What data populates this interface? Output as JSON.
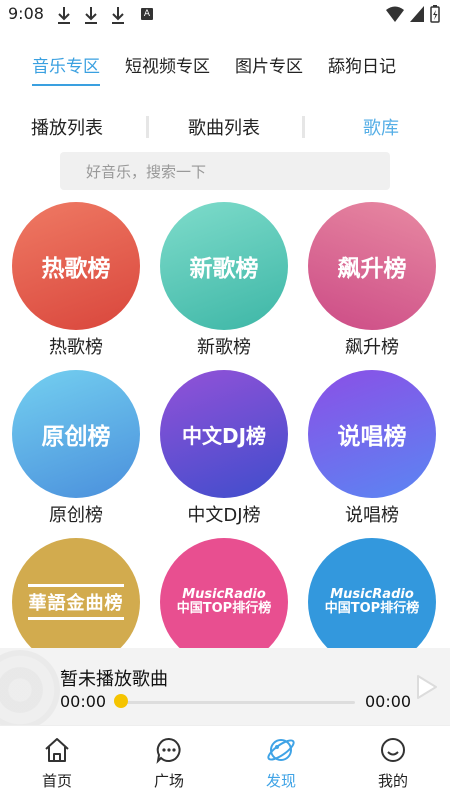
{
  "status_bar": {
    "time": "9:08",
    "notification_letter": "A"
  },
  "top_tabs": [
    {
      "label": "音乐专区",
      "active": true
    },
    {
      "label": "短视频专区",
      "active": false
    },
    {
      "label": "图片专区",
      "active": false
    },
    {
      "label": "舔狗日记",
      "active": false
    }
  ],
  "sub_tabs": [
    {
      "label": "播放列表",
      "active": false
    },
    {
      "label": "歌曲列表",
      "active": false
    },
    {
      "label": "歌库",
      "active": true
    }
  ],
  "search": {
    "placeholder": "好音乐，搜索一下"
  },
  "charts": [
    {
      "circle_text": "热歌榜",
      "caption": "热歌榜",
      "colors": [
        "#ef6a56",
        "#d9483e"
      ]
    },
    {
      "circle_text": "新歌榜",
      "caption": "新歌榜",
      "colors": [
        "#6fd6c5",
        "#3fb8a8"
      ]
    },
    {
      "circle_text": "飙升榜",
      "caption": "飙升榜",
      "colors": [
        "#d45a8d",
        "#e37a9b"
      ]
    },
    {
      "circle_text": "原创榜",
      "caption": "原创榜",
      "colors": [
        "#6cc8ee",
        "#4b93dd"
      ]
    },
    {
      "circle_text": "中文DJ榜",
      "caption": "中文DJ榜",
      "colors": [
        "#8a4fd8",
        "#4a4fd0"
      ]
    },
    {
      "circle_text": "说唱榜",
      "caption": "说唱榜",
      "colors": [
        "#7f55e6",
        "#5a7ef2"
      ]
    },
    {
      "logo_text": "華語金曲榜",
      "caption": "",
      "colors": [
        "#d4ae52",
        "#c8a040"
      ]
    },
    {
      "logo_line1": "MusicRadio",
      "logo_line2": "中国TOP排行榜",
      "caption": "",
      "colors": [
        "#e84c8c",
        "#e85fa0"
      ]
    },
    {
      "logo_line1": "MusicRadio",
      "logo_line2": "中国TOP排行榜",
      "caption": "",
      "colors": [
        "#2f8fd8",
        "#3aa3e6"
      ]
    }
  ],
  "player": {
    "title": "暂未播放歌曲",
    "current_time": "00:00",
    "total_time": "00:00",
    "progress": 0
  },
  "bottom_nav": [
    {
      "label": "首页",
      "icon": "home-icon",
      "active": false
    },
    {
      "label": "广场",
      "icon": "chat-icon",
      "active": false
    },
    {
      "label": "发现",
      "icon": "planet-icon",
      "active": true
    },
    {
      "label": "我的",
      "icon": "smile-icon",
      "active": false
    }
  ],
  "colors": {
    "accent": "#3aa0e0",
    "progress_knob": "#f5c400"
  }
}
